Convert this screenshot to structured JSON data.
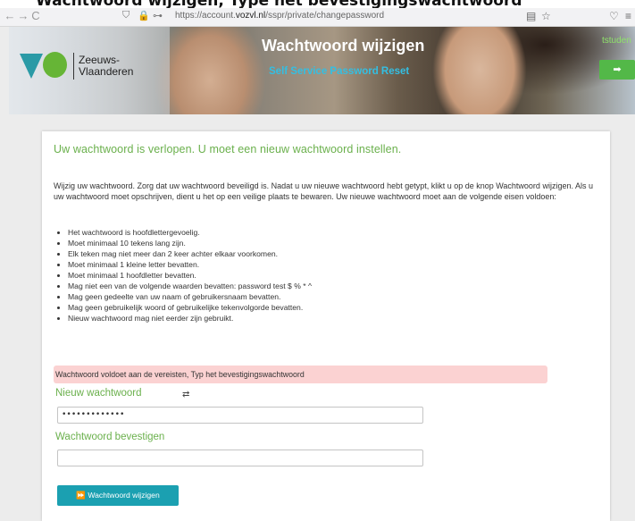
{
  "page_title": "Wachtwoord wijzigen, Type het bevestigingswachtwoord",
  "browser": {
    "back_icon": "←",
    "forward_icon": "→",
    "reload_icon": "C",
    "url_prefix": "https://account.",
    "url_domain": "vozvl.nl",
    "url_path": "/sspr/private/changepassword"
  },
  "header": {
    "logo_line1": "Zeeuws-",
    "logo_line2": "Vlaanderen",
    "title": "Wachtwoord wijzigen",
    "subtitle": "Self Service Password Reset",
    "username": "tstuden",
    "logout_icon": "➡"
  },
  "main": {
    "heading": "Uw wachtwoord is verlopen. U moet een nieuw wachtwoord instellen.",
    "intro": "Wijzig uw wachtwoord. Zorg dat uw wachtwoord beveiligd is. Nadat u uw nieuwe wachtwoord hebt getypt, klikt u op de knop Wachtwoord wijzigen. Als u uw wachtwoord moet opschrijven, dient u het op een veilige plaats te bewaren. Uw nieuwe wachtwoord moet aan de volgende eisen voldoen:",
    "requirements": [
      "Het wachtwoord is hoofdlettergevoelig.",
      "Moet minimaal 10 tekens lang zijn.",
      "Elk teken mag niet meer dan 2 keer achter elkaar voorkomen.",
      "Moet minimaal 1 kleine letter bevatten.",
      "Moet minimaal 1 hoofdletter bevatten.",
      "Mag niet een van de volgende waarden bevatten: password test $ % * ^",
      "Mag geen gedeelte van uw naam of gebruikersnaam bevatten.",
      "Mag geen gebruikelijk woord of gebruikelijke tekenvolgorde bevatten.",
      "Nieuw wachtwoord mag niet eerder zijn gebruikt."
    ],
    "alert": "Wachtwoord voldoet aan de vereisten, Typ het bevestigingswachtwoord",
    "new_password_label": "Nieuw wachtwoord",
    "toggle_icon": "⇄",
    "new_password_value": "•••••••••••••",
    "confirm_password_label": "Wachtwoord bevestigen",
    "confirm_password_value": "",
    "submit_label": "⏩ Wachtwoord wijzigen"
  }
}
